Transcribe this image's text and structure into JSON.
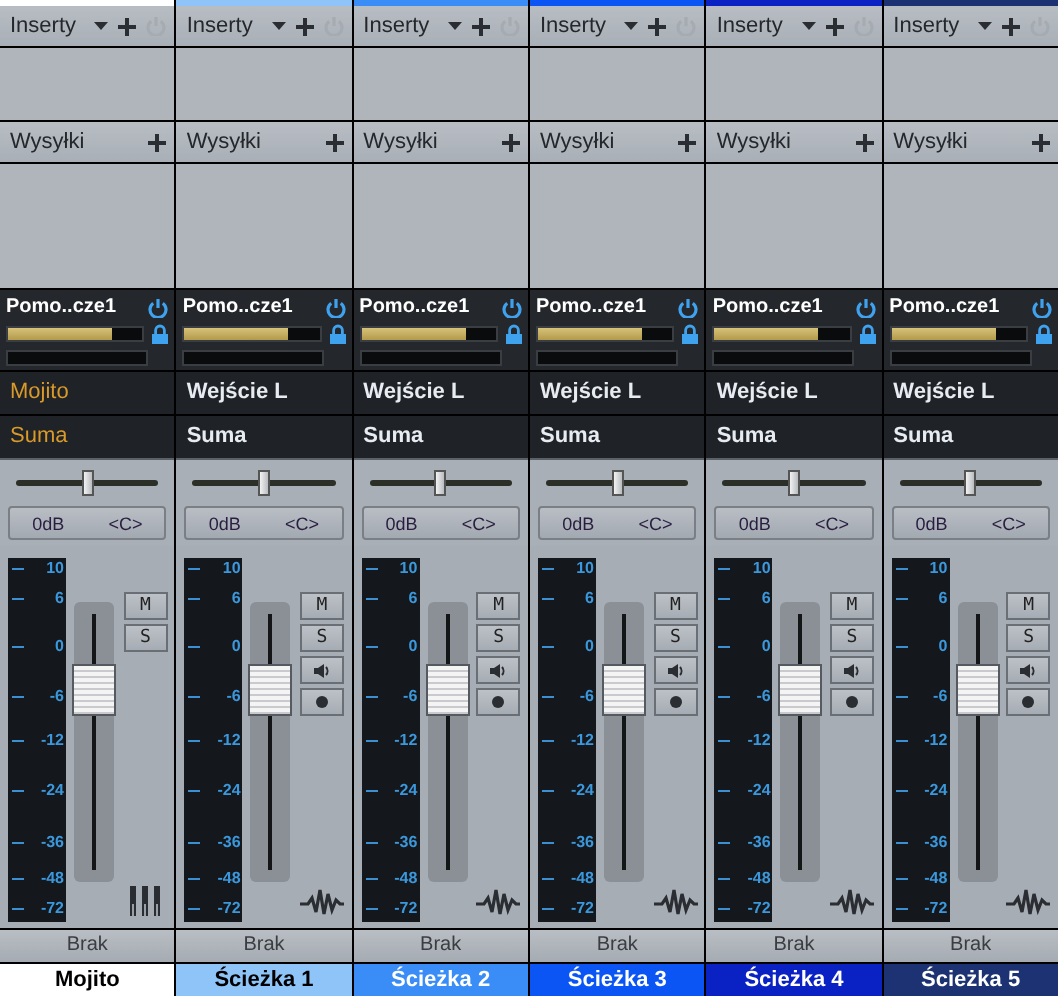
{
  "channels": [
    {
      "kind": "instrument",
      "name": "Mojito",
      "color": "#ffffff",
      "inserts": {
        "label": "Inserty",
        "on": false
      },
      "sends": {
        "label": "Wysyłki"
      },
      "send": {
        "name": "Pomo..cze1",
        "on": true,
        "level": 0.77
      },
      "input": "Mojito",
      "output": "Suma",
      "pan_slider": {
        "level": 0.5
      },
      "volume": "0dB",
      "pan": "<C>",
      "fader": {
        "level": 0.73,
        "scale": [
          "10",
          "6",
          "0",
          "-6",
          "-12",
          "-24",
          "-36",
          "-48",
          "-72"
        ]
      },
      "mute": "M",
      "solo": "S",
      "automation": "Brak"
    },
    {
      "kind": "audio",
      "name": "Ścieżka 1",
      "color": "#8fc4f8",
      "inserts": {
        "label": "Inserty",
        "on": false
      },
      "sends": {
        "label": "Wysyłki"
      },
      "send": {
        "name": "Pomo..cze1",
        "on": true,
        "level": 0.77
      },
      "input": "Wejście L",
      "output": "Suma",
      "pan_slider": {
        "level": 0.5
      },
      "volume": "0dB",
      "pan": "<C>",
      "fader": {
        "level": 0.73,
        "scale": [
          "10",
          "6",
          "0",
          "-6",
          "-12",
          "-24",
          "-36",
          "-48",
          "-72"
        ]
      },
      "mute": "M",
      "solo": "S",
      "automation": "Brak"
    },
    {
      "kind": "audio",
      "name": "Ścieżka 2",
      "color": "#3a8cf6",
      "inserts": {
        "label": "Inserty",
        "on": false
      },
      "sends": {
        "label": "Wysyłki"
      },
      "send": {
        "name": "Pomo..cze1",
        "on": true,
        "level": 0.77
      },
      "input": "Wejście L",
      "output": "Suma",
      "pan_slider": {
        "level": 0.5
      },
      "volume": "0dB",
      "pan": "<C>",
      "fader": {
        "level": 0.73,
        "scale": [
          "10",
          "6",
          "0",
          "-6",
          "-12",
          "-24",
          "-36",
          "-48",
          "-72"
        ]
      },
      "mute": "M",
      "solo": "S",
      "automation": "Brak"
    },
    {
      "kind": "audio",
      "name": "Ścieżka 3",
      "color": "#0a55f4",
      "inserts": {
        "label": "Inserty",
        "on": false
      },
      "sends": {
        "label": "Wysyłki"
      },
      "send": {
        "name": "Pomo..cze1",
        "on": true,
        "level": 0.77
      },
      "input": "Wejście L",
      "output": "Suma",
      "pan_slider": {
        "level": 0.5
      },
      "volume": "0dB",
      "pan": "<C>",
      "fader": {
        "level": 0.73,
        "scale": [
          "10",
          "6",
          "0",
          "-6",
          "-12",
          "-24",
          "-36",
          "-48",
          "-72"
        ]
      },
      "mute": "M",
      "solo": "S",
      "automation": "Brak"
    },
    {
      "kind": "audio",
      "name": "Ścieżka 4",
      "color": "#0a22c4",
      "inserts": {
        "label": "Inserty",
        "on": false
      },
      "sends": {
        "label": "Wysyłki"
      },
      "send": {
        "name": "Pomo..cze1",
        "on": true,
        "level": 0.77
      },
      "input": "Wejście L",
      "output": "Suma",
      "pan_slider": {
        "level": 0.5
      },
      "volume": "0dB",
      "pan": "<C>",
      "fader": {
        "level": 0.73,
        "scale": [
          "10",
          "6",
          "0",
          "-6",
          "-12",
          "-24",
          "-36",
          "-48",
          "-72"
        ]
      },
      "mute": "M",
      "solo": "S",
      "automation": "Brak"
    },
    {
      "kind": "audio",
      "name": "Ścieżka 5",
      "color": "#1c3272",
      "inserts": {
        "label": "Inserty",
        "on": false
      },
      "sends": {
        "label": "Wysyłki"
      },
      "send": {
        "name": "Pomo..cze1",
        "on": true,
        "level": 0.77
      },
      "input": "Wejście L",
      "output": "Suma",
      "pan_slider": {
        "level": 0.5
      },
      "volume": "0dB",
      "pan": "<C>",
      "fader": {
        "level": 0.73,
        "scale": [
          "10",
          "6",
          "0",
          "-6",
          "-12",
          "-24",
          "-36",
          "-48",
          "-72"
        ]
      },
      "mute": "M",
      "solo": "S",
      "automation": "Brak"
    }
  ]
}
